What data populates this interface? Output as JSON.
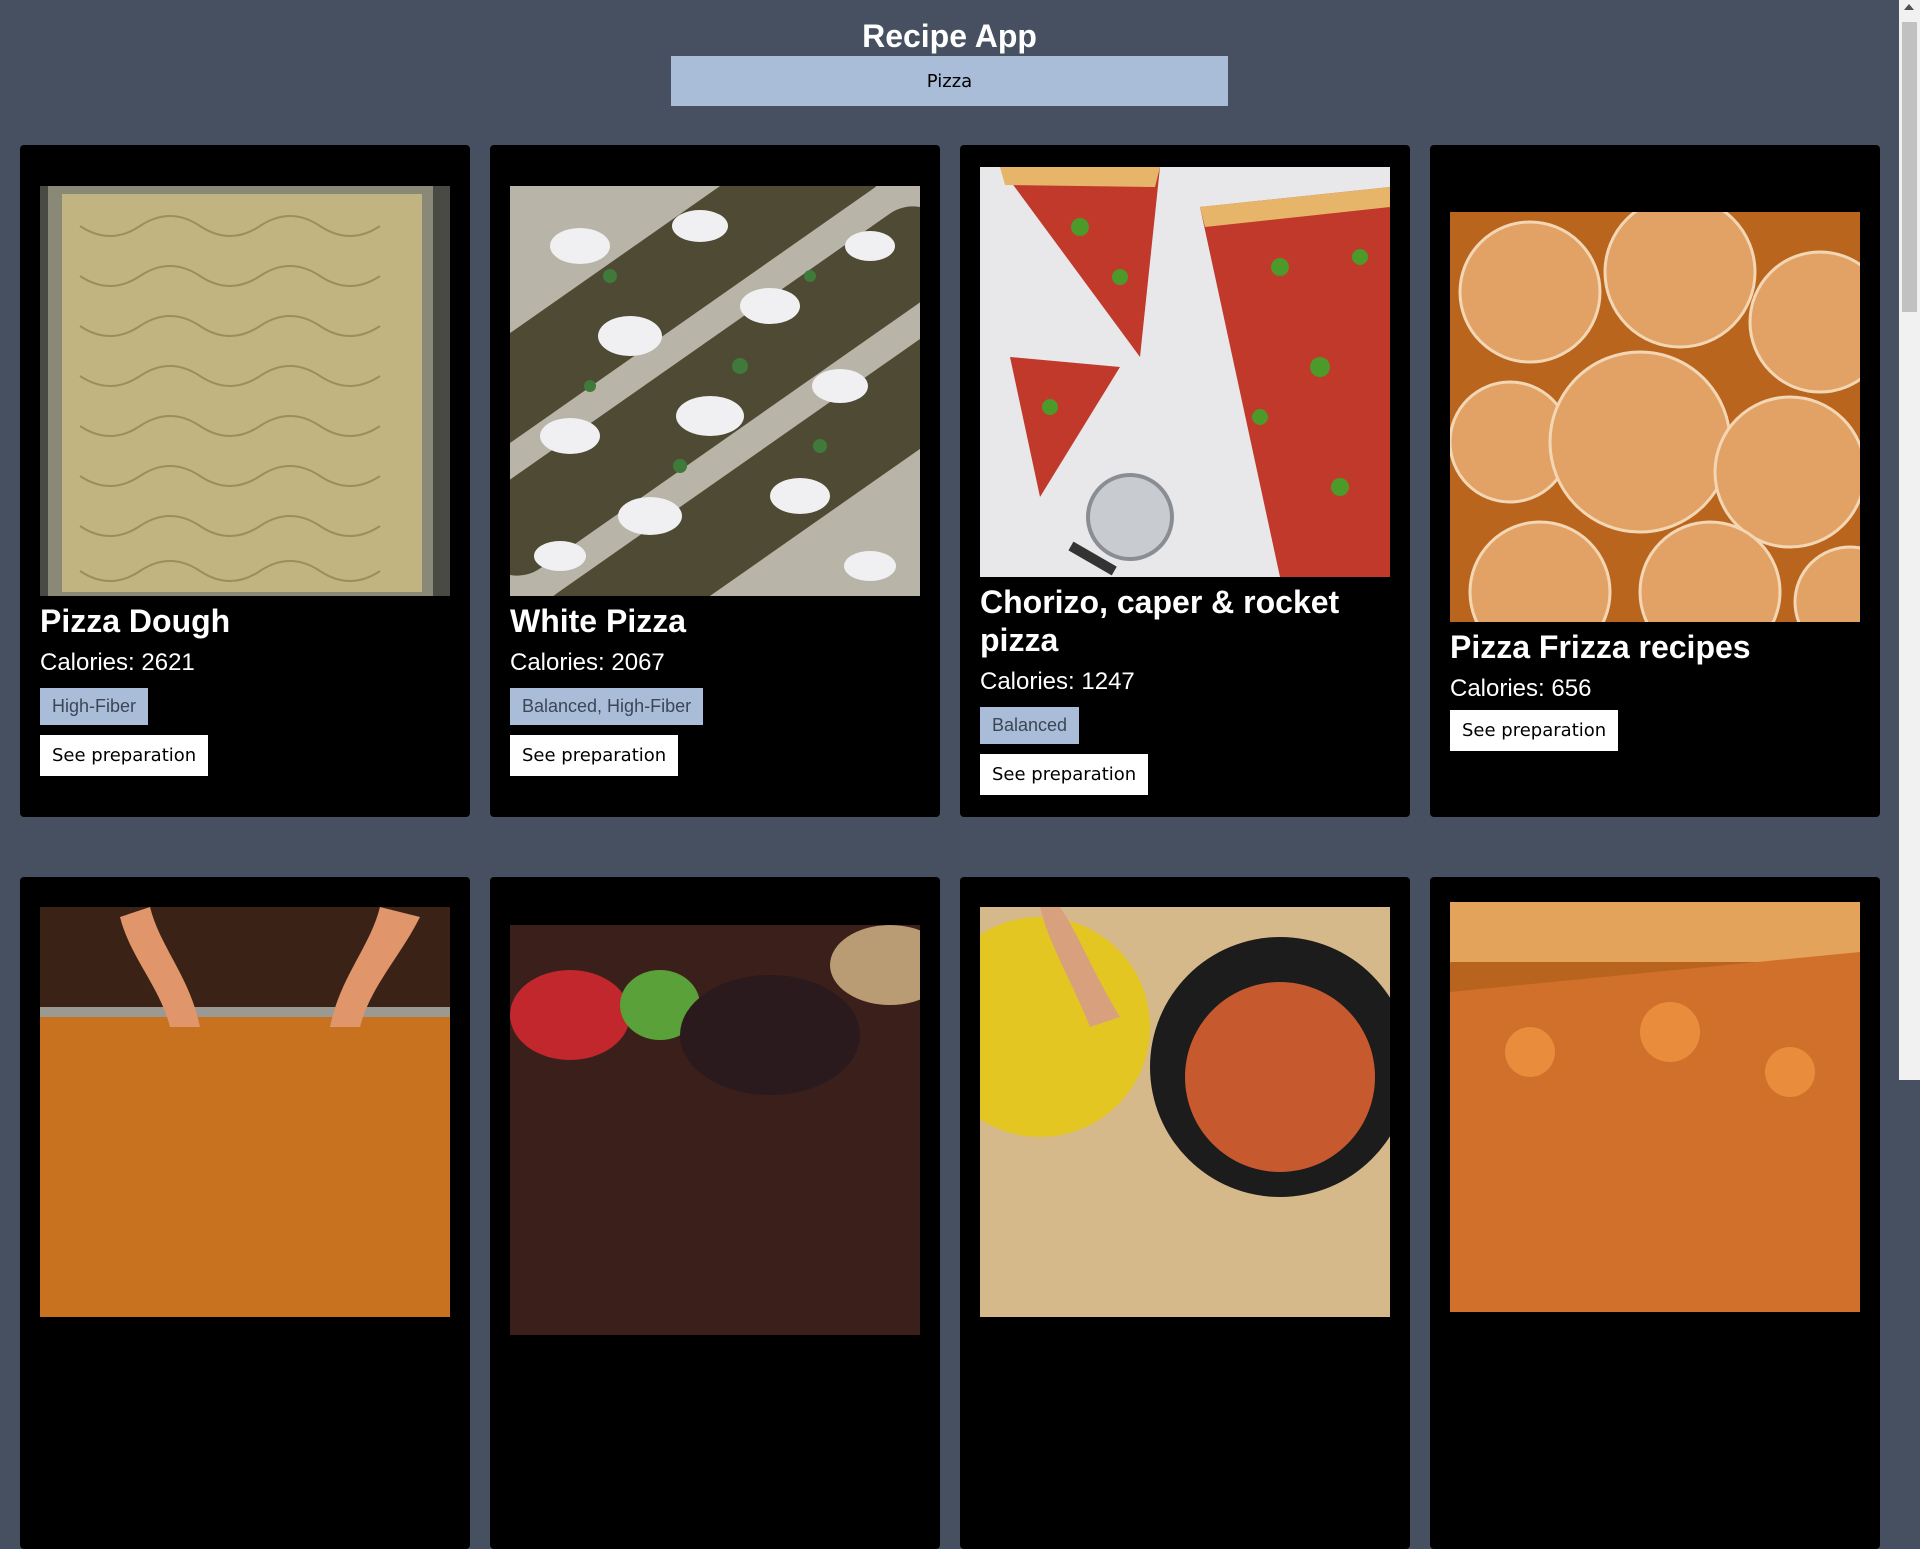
{
  "app": {
    "title": "Recipe App"
  },
  "search": {
    "value": "Pizza",
    "placeholder": ""
  },
  "recipes": [
    {
      "title": "Pizza Dough",
      "calories": "Calories: 2621",
      "tags": "High-Fiber",
      "button": "See preparation",
      "image": "pizza-dough-photo"
    },
    {
      "title": "White Pizza",
      "calories": "Calories: 2067",
      "tags": "Balanced, High-Fiber",
      "button": "See preparation",
      "image": "white-pizza-photo"
    },
    {
      "title": "Chorizo, caper & rocket pizza",
      "calories": "Calories: 1247",
      "tags": "Balanced",
      "button": "See preparation",
      "image": "chorizo-pizza-photo"
    },
    {
      "title": "Pizza Frizza recipes",
      "calories": "Calories: 656",
      "tags": "",
      "button": "See preparation",
      "image": "pizza-frizza-photo"
    },
    {
      "image": "pizza-hands-photo"
    },
    {
      "image": "salad-pizza-photo"
    },
    {
      "image": "skillet-pizza-photo"
    },
    {
      "image": "cheese-pizza-photo"
    }
  ],
  "colors": {
    "background": "#465060",
    "card": "#000000",
    "search": "#aabdd8",
    "tag": "#aabdd8"
  }
}
